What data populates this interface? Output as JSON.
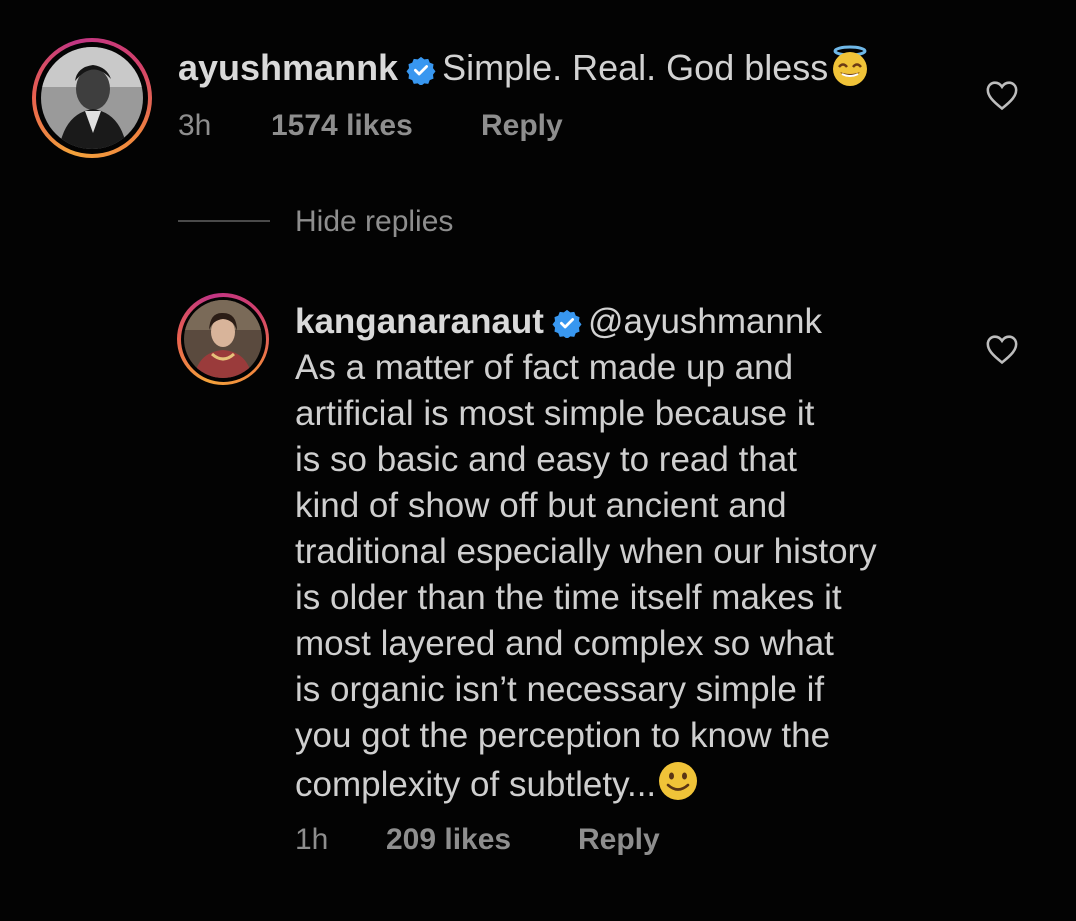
{
  "comment": {
    "username": "ayushmannk",
    "text": "Simple. Real. God bless",
    "emoji": "smiling-face-with-halo",
    "time": "3h",
    "likes": "1574 likes",
    "reply_label": "Reply"
  },
  "replies_toggle": "Hide replies",
  "reply": {
    "username": "kanganaranaut",
    "mention": "@ayushmannk",
    "lines": [
      "As a matter of fact made up and",
      "artificial is most simple because it",
      "is so basic and easy to read that",
      "kind of show off but ancient and",
      "traditional especially when our history",
      "is older than the time itself makes it",
      "most layered and complex so what",
      "is organic isn’t necessary simple if",
      "you got the perception to know the",
      "complexity of subtlety..."
    ],
    "emoji": "slightly-smiling-face",
    "time": "1h",
    "likes": "209 likes",
    "reply_label": "Reply"
  },
  "colors": {
    "background": "#030303",
    "text": "#d6d6d6",
    "secondary": "#8e8e8e",
    "verified": "#3897f0"
  }
}
